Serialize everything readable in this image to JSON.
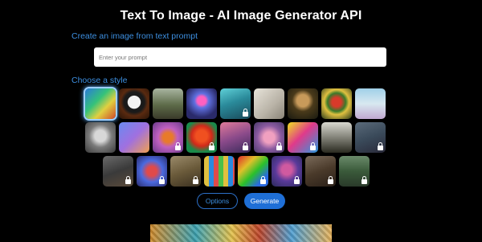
{
  "header": {
    "title": "Text To Image - AI Image Generator API"
  },
  "prompt_section": {
    "label": "Create an image from text prompt",
    "placeholder": "Enter your prompt",
    "value": ""
  },
  "style_section": {
    "label": "Choose a style",
    "rows": [
      [
        {
          "name": "style-psychedelic-waves",
          "locked": false,
          "selected": true,
          "bg": "linear-gradient(135deg,#2a7bd8,#34c27a 40%,#e0d040 65%,#d04a2a)"
        },
        {
          "name": "style-panda",
          "locked": false,
          "selected": false,
          "bg": "radial-gradient(circle at 50% 45%,#f2f2f2 0 28%,#1a1a1a 30% 45%,#5a2a10 60%,#2a1508)"
        },
        {
          "name": "style-forest-landscape",
          "locked": false,
          "selected": false,
          "bg": "linear-gradient(180deg,#a8b4a0,#5c6a48 55%,#3a3a2a)"
        },
        {
          "name": "style-robot",
          "locked": false,
          "selected": false,
          "bg": "radial-gradient(circle at 50% 40%,#ff60c0 0 18%,#6070e0 30%,#2a2a6a 70%)"
        },
        {
          "name": "style-anime-portrait",
          "locked": true,
          "selected": false,
          "bg": "linear-gradient(160deg,#5fd0d8,#2a8a9a 45%,#1a4a5a)"
        },
        {
          "name": "style-pencil-sketch",
          "locked": false,
          "selected": false,
          "bg": "linear-gradient(135deg,#e8e4da,#b8b2a6 60%,#8a8478)"
        },
        {
          "name": "style-renaissance",
          "locked": false,
          "selected": false,
          "bg": "radial-gradient(circle at 50% 40%,#c89a5a 0 25%,#4a3a1a 45%,#1a1a10)"
        },
        {
          "name": "style-flower-still-life",
          "locked": false,
          "selected": false,
          "bg": "radial-gradient(circle at 50% 45%,#d83a2a 0 20%,#3a7a2a 40%,#e0c040 55%,#2a3a1a)"
        },
        {
          "name": "style-ballet-fantasy",
          "locked": false,
          "selected": false,
          "bg": "linear-gradient(180deg,#a0d0e8,#d8e8f0 50%,#c0a8d0)"
        }
      ],
      [
        {
          "name": "style-3d-metal-cup",
          "locked": false,
          "selected": false,
          "bg": "radial-gradient(circle at 50% 45%,#d8d8d8 0 25%,#7a7a7a 50%,#3a3a3a)"
        },
        {
          "name": "style-isometric-room",
          "locked": false,
          "selected": false,
          "bg": "linear-gradient(135deg,#6a8af0,#a070e0 50%,#f0a050)"
        },
        {
          "name": "style-fox-illustration",
          "locked": true,
          "selected": false,
          "bg": "radial-gradient(circle at 50% 50%,#e87a2a 0 22%,#c060c0 45%,#6a3a8a)"
        },
        {
          "name": "style-neon-face",
          "locked": true,
          "selected": false,
          "bg": "radial-gradient(circle at 50% 45%,#f05020 0 25%,#d02a1a 45%,#1a8a4a 70%)"
        },
        {
          "name": "style-soft-portrait",
          "locked": true,
          "selected": false,
          "bg": "linear-gradient(160deg,#e07a9a,#8a4a8a 50%,#3a2a5a)"
        },
        {
          "name": "style-pink-glow",
          "locked": true,
          "selected": false,
          "bg": "radial-gradient(circle at 50% 50%,#f0a0c0 0 25%,#8a5aa0 55%,#4a3a6a)"
        },
        {
          "name": "style-pop-art",
          "locked": true,
          "selected": false,
          "bg": "linear-gradient(135deg,#f0e020,#e03a8a 45%,#2a9ae0)"
        },
        {
          "name": "style-architecture-house",
          "locked": false,
          "selected": false,
          "bg": "linear-gradient(180deg,#d8d8d0,#7a7a70 55%,#2a2a20)"
        },
        {
          "name": "style-grey-portrait",
          "locked": true,
          "selected": false,
          "bg": "linear-gradient(160deg,#5a6a7a,#3a4a5a 50%,#2a2a3a)"
        }
      ],
      [
        {
          "name": "style-blurred-figure",
          "locked": true,
          "selected": false,
          "bg": "linear-gradient(160deg,#6a6a6a,#3a3a3a 50%,#5a4a3a)"
        },
        {
          "name": "style-colorful-creature",
          "locked": true,
          "selected": false,
          "bg": "radial-gradient(circle at 50% 50%,#e04a4a 0 22%,#4a6ae0 50%,#2a2a6a)"
        },
        {
          "name": "style-vintage-photo",
          "locked": true,
          "selected": false,
          "bg": "linear-gradient(160deg,#9a8a6a,#6a5a3a 50%,#3a3020)"
        },
        {
          "name": "style-sticker-pattern",
          "locked": false,
          "selected": false,
          "bg": "repeating-linear-gradient(90deg,#e0c040 0 6px,#2a8ae0 6px 12px,#e04a4a 12px 18px,#4ac04a 18px 24px)"
        },
        {
          "name": "style-rainbow-abstract",
          "locked": true,
          "selected": false,
          "bg": "linear-gradient(135deg,#e02a2a,#e0c02a 30%,#2ac02a 55%,#2a6ae0 80%)"
        },
        {
          "name": "style-fantasy-girl",
          "locked": true,
          "selected": false,
          "bg": "radial-gradient(circle at 50% 45%,#d05aa0 0 22%,#5a3a9a 50%,#2a2a5a)"
        },
        {
          "name": "style-dark-portrait",
          "locked": true,
          "selected": false,
          "bg": "linear-gradient(160deg,#7a6a5a,#4a3a2a 50%,#2a2018)"
        },
        {
          "name": "style-forest-scene",
          "locked": true,
          "selected": false,
          "bg": "linear-gradient(180deg,#6a8a6a,#3a5a3a 50%,#2a3a2a)"
        }
      ]
    ]
  },
  "actions": {
    "options_label": "Options",
    "generate_label": "Generate"
  }
}
